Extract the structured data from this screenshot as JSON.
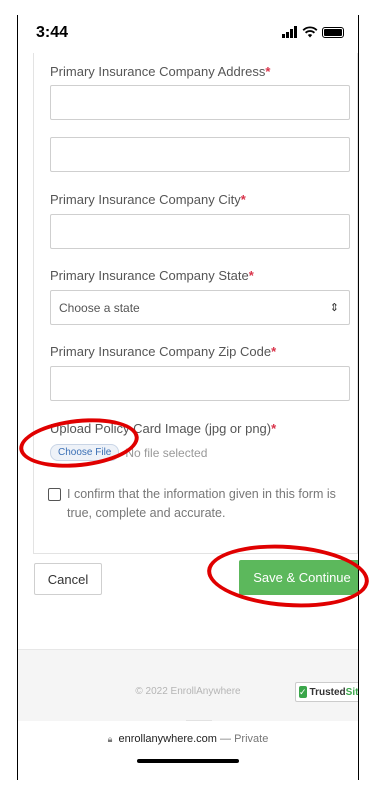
{
  "status_bar": {
    "time": "3:44"
  },
  "form": {
    "address_label": "Primary Insurance Company Address",
    "city_label": "Primary Insurance Company City",
    "state_label": "Primary Insurance Company State",
    "state_select_value": "Choose a state",
    "zip_label": "Primary Insurance Company Zip Code",
    "required_marker": "*",
    "upload_label": "Upload Policy Card Image (jpg or png)",
    "choose_file_label": "Choose File",
    "file_status": "No file selected",
    "confirm_text": "I confirm that the information given in this form is true, complete and accurate."
  },
  "actions": {
    "cancel_label": "Cancel",
    "save_label": "Save & Continue"
  },
  "footer": {
    "copyright": "© 2022 EnrollAnywhere",
    "badge_prefix": "Trusted",
    "badge_suffix": "Site"
  },
  "browser": {
    "domain": "enrollanywhere.com",
    "mode": "— Private"
  },
  "colors": {
    "accent_green": "#5cb85c",
    "required_red": "#d9334a",
    "annotation_red": "#e00000"
  }
}
